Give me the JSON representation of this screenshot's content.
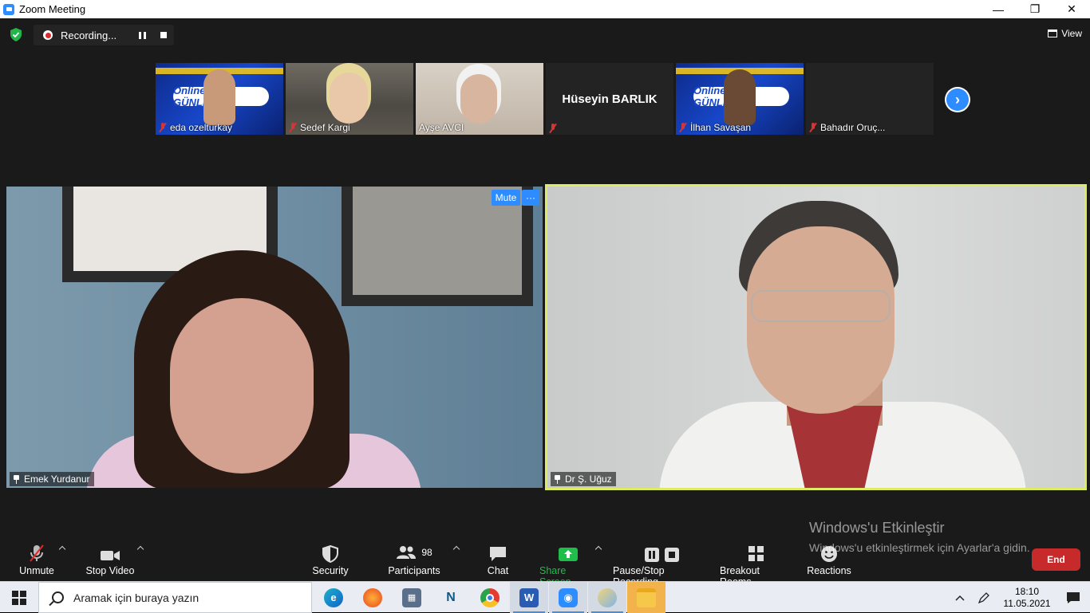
{
  "window": {
    "title": "Zoom Meeting"
  },
  "recording": {
    "status": "Recording..."
  },
  "view_label": "View",
  "thumbnails": [
    {
      "name": "eda ozelturkay",
      "banner_text": "Online KAR GÜNLERİ"
    },
    {
      "name": "Sedef Kargi"
    },
    {
      "name": "Ayşe AVCI"
    },
    {
      "name": "",
      "display_name": "Hüseyin BARLIK"
    },
    {
      "name": "İlhan Savaşan",
      "banner_text": "Online KAR GÜNLERİ"
    },
    {
      "name": "Bahadır Oruç..."
    }
  ],
  "main_videos": {
    "left": {
      "name": "Emek Yurdanur",
      "mute_label": "Mute",
      "more_label": "···"
    },
    "right": {
      "name": "Dr Ş. Uğuz"
    }
  },
  "watermark": {
    "title": "Windows'u Etkinleştir",
    "subtitle": "Windows'u etkinleştirmek için Ayarlar'a gidin."
  },
  "toolbar": {
    "unmute": "Unmute",
    "stop_video": "Stop Video",
    "security": "Security",
    "participants": "Participants",
    "participants_count": "98",
    "chat": "Chat",
    "share_screen": "Share Screen",
    "pause_stop_recording": "Pause/Stop Recording",
    "breakout_rooms": "Breakout Rooms",
    "reactions": "Reactions",
    "end": "End"
  },
  "taskbar": {
    "search_placeholder": "Aramak için buraya yazın",
    "time": "18:10",
    "date": "11.05.2021"
  },
  "colors": {
    "zoom_blue": "#2d8cff",
    "active_speaker_border": "#dcea64",
    "share_green": "#1fbd4a",
    "end_red": "#c72a2a",
    "mic_muted_red": "#d43535"
  }
}
